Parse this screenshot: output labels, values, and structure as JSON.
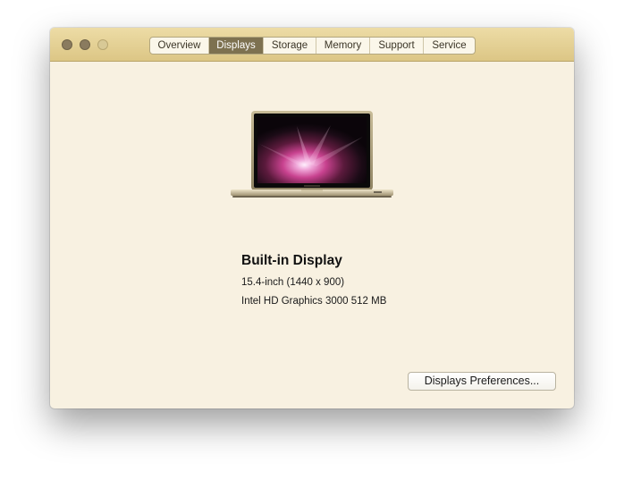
{
  "window": {
    "tabs": [
      {
        "label": "Overview",
        "active": false
      },
      {
        "label": "Displays",
        "active": true
      },
      {
        "label": "Storage",
        "active": false
      },
      {
        "label": "Memory",
        "active": false
      },
      {
        "label": "Support",
        "active": false
      },
      {
        "label": "Service",
        "active": false
      }
    ]
  },
  "display": {
    "name": "Built-in Display",
    "size": "15.4-inch (1440 x 900)",
    "graphics": "Intel HD Graphics 3000 512 MB"
  },
  "laptop_image": {
    "label": "MacBook Pro",
    "icon": "macbook-pro-laptop-icon"
  },
  "actions": {
    "preferences_label": "Displays Preferences..."
  },
  "colors": {
    "titlebar": "#dcc685",
    "window_bg": "#f8f1e1",
    "active_tab": "#7d7150"
  }
}
